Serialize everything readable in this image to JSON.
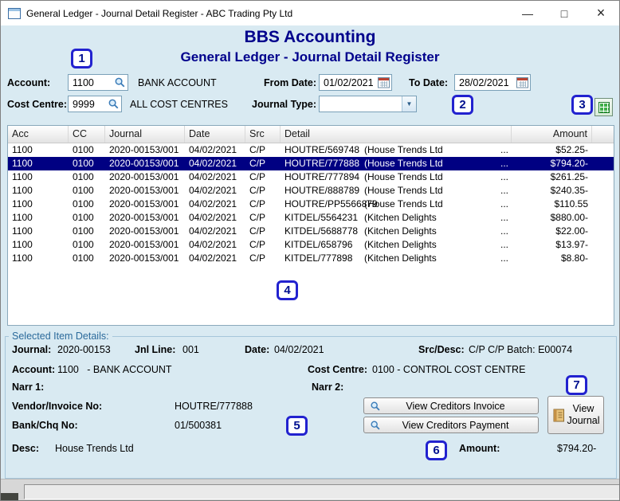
{
  "window": {
    "title": "General Ledger - Journal Detail Register - ABC Trading Pty Ltd",
    "minimize": "—",
    "maximize": "□",
    "close": "×"
  },
  "header": {
    "app_title": "BBS Accounting",
    "page_title": "General Ledger - Journal Detail Register"
  },
  "filters": {
    "account_label": "Account:",
    "account_value": "1100",
    "account_desc": "BANK ACCOUNT",
    "from_date_label": "From Date:",
    "from_date_value": "01/02/2021",
    "to_date_label": "To Date:",
    "to_date_value": "28/02/2021",
    "cost_centre_label": "Cost Centre:",
    "cost_centre_value": "9999",
    "cost_centre_desc": "ALL COST CENTRES",
    "journal_type_label": "Journal Type:",
    "journal_type_value": ""
  },
  "callouts": {
    "c1": "1",
    "c2": "2",
    "c3": "3",
    "c4": "4",
    "c5": "5",
    "c6": "6",
    "c7": "7"
  },
  "table": {
    "columns": {
      "acc": "Acc",
      "cc": "CC",
      "journal": "Journal",
      "date": "Date",
      "src": "Src",
      "detail": "Detail",
      "amount": "Amount"
    },
    "rows": [
      {
        "acc": "1100",
        "cc": "0100",
        "journal": "2020-00153/001",
        "date": "04/02/2021",
        "src": "C/P",
        "ref": "HOUTRE/569748",
        "name": "(House Trends Ltd",
        "more": "...",
        "amount": "$52.25-"
      },
      {
        "acc": "1100",
        "cc": "0100",
        "journal": "2020-00153/001",
        "date": "04/02/2021",
        "src": "C/P",
        "ref": "HOUTRE/777888",
        "name": "(House Trends Ltd",
        "more": "...",
        "amount": "$794.20-"
      },
      {
        "acc": "1100",
        "cc": "0100",
        "journal": "2020-00153/001",
        "date": "04/02/2021",
        "src": "C/P",
        "ref": "HOUTRE/777894",
        "name": "(House Trends Ltd",
        "more": "...",
        "amount": "$261.25-"
      },
      {
        "acc": "1100",
        "cc": "0100",
        "journal": "2020-00153/001",
        "date": "04/02/2021",
        "src": "C/P",
        "ref": "HOUTRE/888789",
        "name": "(House Trends Ltd",
        "more": "...",
        "amount": "$240.35-"
      },
      {
        "acc": "1100",
        "cc": "0100",
        "journal": "2020-00153/001",
        "date": "04/02/2021",
        "src": "C/P",
        "ref": "HOUTRE/PP5566879",
        "name": "(House Trends Ltd",
        "more": "...",
        "amount": "$110.55"
      },
      {
        "acc": "1100",
        "cc": "0100",
        "journal": "2020-00153/001",
        "date": "04/02/2021",
        "src": "C/P",
        "ref": "KITDEL/5564231",
        "name": "(Kitchen Delights",
        "more": "...",
        "amount": "$880.00-"
      },
      {
        "acc": "1100",
        "cc": "0100",
        "journal": "2020-00153/001",
        "date": "04/02/2021",
        "src": "C/P",
        "ref": "KITDEL/5688778",
        "name": "(Kitchen Delights",
        "more": "...",
        "amount": "$22.00-"
      },
      {
        "acc": "1100",
        "cc": "0100",
        "journal": "2020-00153/001",
        "date": "04/02/2021",
        "src": "C/P",
        "ref": "KITDEL/658796",
        "name": "(Kitchen Delights",
        "more": "...",
        "amount": "$13.97-"
      },
      {
        "acc": "1100",
        "cc": "0100",
        "journal": "2020-00153/001",
        "date": "04/02/2021",
        "src": "C/P",
        "ref": "KITDEL/777898",
        "name": "(Kitchen Delights",
        "more": "...",
        "amount": "$8.80-"
      }
    ]
  },
  "details": {
    "section_title": "Selected Item Details:",
    "journal_label": "Journal:",
    "journal_value": "2020-00153",
    "jnl_line_label": "Jnl Line:",
    "jnl_line_value": "001",
    "date_label": "Date:",
    "date_value": "04/02/2021",
    "src_desc_label": "Src/Desc:",
    "src_desc_value": "C/P C/P Batch: E00074",
    "account_label": "Account:",
    "account_value": "1100   - BANK ACCOUNT",
    "cost_centre_label": "Cost Centre:",
    "cost_centre_value": "0100 - CONTROL COST CENTRE",
    "narr1_label": "Narr 1:",
    "narr2_label": "Narr 2:",
    "vendor_invoice_label": "Vendor/Invoice No:",
    "vendor_invoice_value": "HOUTRE/777888",
    "bank_chq_label": "Bank/Chq No:",
    "bank_chq_value": "01/500381",
    "desc_label": "Desc:",
    "desc_value": "House Trends Ltd",
    "amount_label": "Amount:",
    "amount_value": "$794.20-",
    "view_invoice_button": "View Creditors Invoice",
    "view_payment_button": "View Creditors Payment",
    "view_journal_button": "View Journal"
  }
}
